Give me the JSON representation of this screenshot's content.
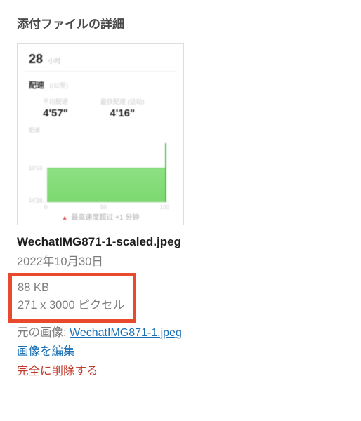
{
  "panel": {
    "title": "添付ファイルの詳細",
    "filename": "WechatIMG871-1-scaled.jpeg",
    "date": "2022年10月30日",
    "filesize": "88 KB",
    "dimensions": "271 x 3000 ピクセル",
    "original_label": "元の画像:",
    "original_filename": "WechatIMG871-1.jpeg",
    "edit_label": "画像を編集",
    "delete_label": "完全に削除する"
  },
  "thumbnail": {
    "top_value": "28",
    "top_unit": "小时",
    "section_label": "配速",
    "section_sub": "(/公里)",
    "col1_label": "平均配速",
    "col1_value": "4'57\"",
    "col2_label": "最快配速 (运动)",
    "col2_value": "4'16\"",
    "side_label": "配速",
    "y1": "10'03",
    "y2": "14'59",
    "x1": "0",
    "x2": "50",
    "x3": "100",
    "bottom_text": "最高速度超过 +1 分钟"
  }
}
